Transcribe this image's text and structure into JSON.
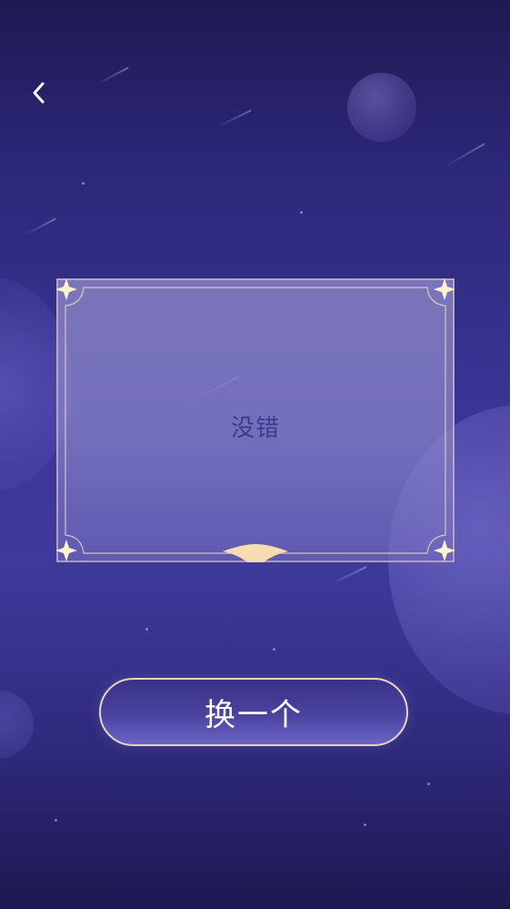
{
  "header": {
    "back_icon": "chevron-left-icon"
  },
  "card": {
    "text": "没错"
  },
  "actions": {
    "swap_label": "换一个"
  },
  "colors": {
    "background_top": "#1f1a52",
    "background_mid": "#3e3a9c",
    "card_text": "#3e3a8c",
    "frame_gold": "#e9d6b8",
    "sparkle": "#fff3cf",
    "button_fill": "#4a43a0"
  }
}
